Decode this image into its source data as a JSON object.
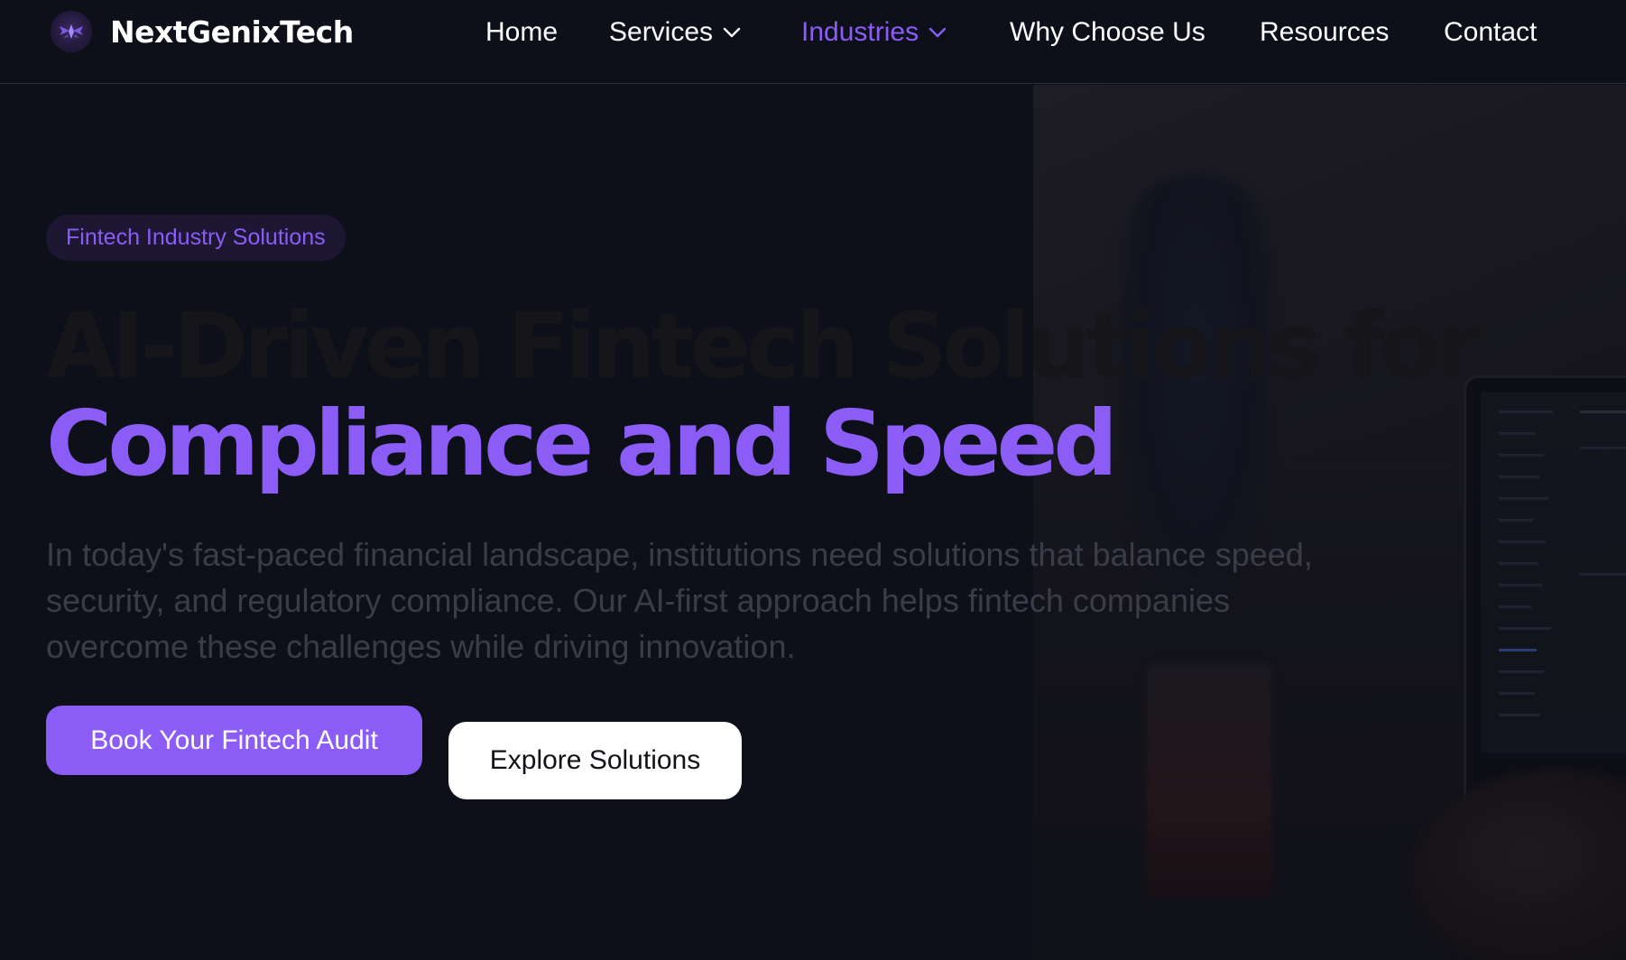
{
  "brand": {
    "name": "NextGenixTech",
    "logo_icon": "winged-emblem-icon"
  },
  "nav": {
    "items": [
      {
        "label": "Home",
        "has_dropdown": false,
        "active": false
      },
      {
        "label": "Services",
        "has_dropdown": true,
        "active": false
      },
      {
        "label": "Industries",
        "has_dropdown": true,
        "active": true
      },
      {
        "label": "Why Choose Us",
        "has_dropdown": false,
        "active": false
      },
      {
        "label": "Resources",
        "has_dropdown": false,
        "active": false
      },
      {
        "label": "Contact",
        "has_dropdown": false,
        "active": false
      }
    ]
  },
  "hero": {
    "badge": "Fintech Industry Solutions",
    "headline_line1": "AI-Driven Fintech Solutions for",
    "headline_line2": "Compliance and Speed",
    "description": "In today's fast-paced financial landscape, institutions need solutions that balance speed, security, and regulatory compliance. Our AI-first approach helps fintech companies overcome these challenges while driving innovation.",
    "primary_cta": "Book Your Fintech Audit",
    "secondary_cta": "Explore Solutions"
  },
  "colors": {
    "accent": "#8b5cf6",
    "background": "#0e1019",
    "badge_bg": "#1d1733",
    "text_white": "#ffffff"
  }
}
